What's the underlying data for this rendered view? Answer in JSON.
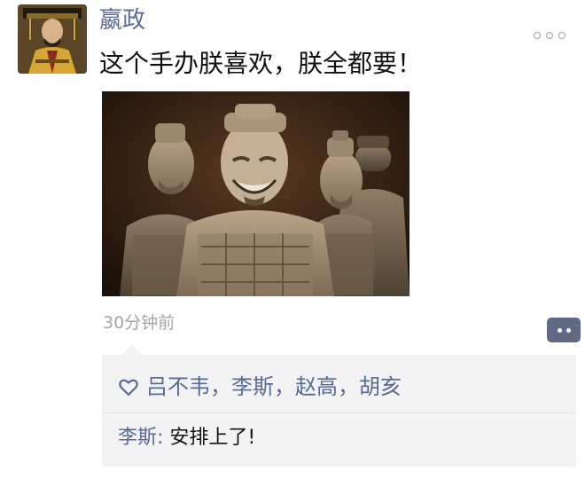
{
  "post": {
    "author": "嬴政",
    "text": "这个手办朕喜欢，朕全都要！",
    "timestamp": "30分钟前",
    "avatar_icon": "emperor-portrait-icon",
    "photo_icon": "terracotta-warriors-photo",
    "more_icon": "more-dots-icon",
    "comment_icon": "comment-bubble-icon"
  },
  "interactions": {
    "like_icon": "heart-icon",
    "likes": "吕不韦，李斯，赵高，胡亥",
    "comments": [
      {
        "author": "李斯",
        "separator": ": ",
        "text": "安排上了!"
      }
    ]
  },
  "colors": {
    "name_blue": "#576b95",
    "timestamp_gray": "#a5a5a5",
    "panel_bg": "#f3f3f5",
    "comment_button": "#5f6b84"
  }
}
